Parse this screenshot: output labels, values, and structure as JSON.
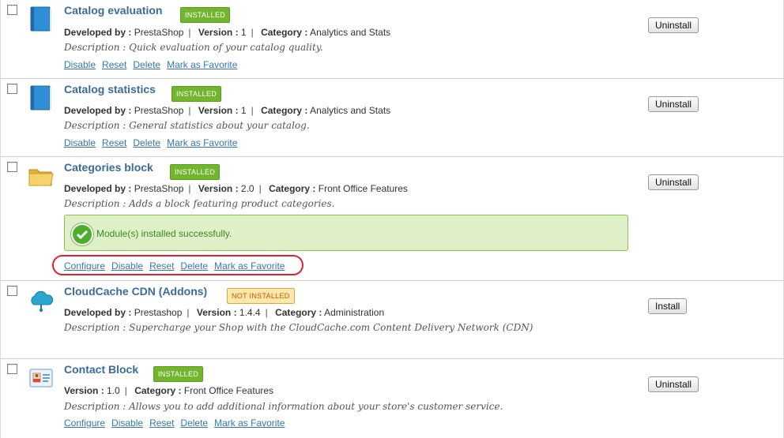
{
  "modules": [
    {
      "title": "Catalog evaluation",
      "badge": "INSTALLED",
      "developer_label": "Developed by :",
      "developer": "PrestaShop",
      "version_label": "Version :",
      "version": "1",
      "category_label": "Category :",
      "category": "Analytics and Stats",
      "description": "Description : Quick evaluation of your catalog quality.",
      "links": [
        "Disable",
        "Reset",
        "Delete",
        "Mark as Favorite"
      ],
      "button": "Uninstall",
      "icon": "book-icon"
    },
    {
      "title": "Catalog statistics",
      "badge": "INSTALLED",
      "developer_label": "Developed by :",
      "developer": "PrestaShop",
      "version_label": "Version :",
      "version": "1",
      "category_label": "Category :",
      "category": "Analytics and Stats",
      "description": "Description : General statistics about your catalog.",
      "links": [
        "Disable",
        "Reset",
        "Delete",
        "Mark as Favorite"
      ],
      "button": "Uninstall",
      "icon": "book-icon"
    },
    {
      "title": "Categories block",
      "badge": "INSTALLED",
      "developer_label": "Developed by :",
      "developer": "PrestaShop",
      "version_label": "Version :",
      "version": "2.0",
      "category_label": "Category :",
      "category": "Front Office Features",
      "description": "Description : Adds a block featuring product categories.",
      "success": "Module(s) installed successfully.",
      "links": [
        "Configure",
        "Disable",
        "Reset",
        "Delete",
        "Mark as Favorite"
      ],
      "button": "Uninstall",
      "icon": "folder-icon"
    },
    {
      "title": "CloudCache CDN (Addons)",
      "badge": "NOT INSTALLED",
      "developer_label": "Developed by :",
      "developer": "Prestashop",
      "version_label": "Version :",
      "version": "1.4.4",
      "category_label": "Category :",
      "category": "Administration",
      "description": "Description : Supercharge your Shop with the CloudCache.com Content Delivery Network (CDN)",
      "links": [],
      "button": "Install",
      "icon": "cloud-icon"
    },
    {
      "title": "Contact Block",
      "badge": "INSTALLED",
      "version_label": "Version :",
      "version": "1.0",
      "category_label": "Category :",
      "category": "Front Office Features",
      "description": "Description : Allows you to add additional information about your store's customer service.",
      "links": [
        "Configure",
        "Disable",
        "Reset",
        "Delete",
        "Mark as Favorite"
      ],
      "button": "Uninstall",
      "icon": "contact-card-icon"
    }
  ],
  "colors": {
    "installed": "#72b62d",
    "not_installed": "#fce8a8",
    "link": "#3576b1",
    "title": "#3b6b9b",
    "highlight": "#d9262d"
  }
}
